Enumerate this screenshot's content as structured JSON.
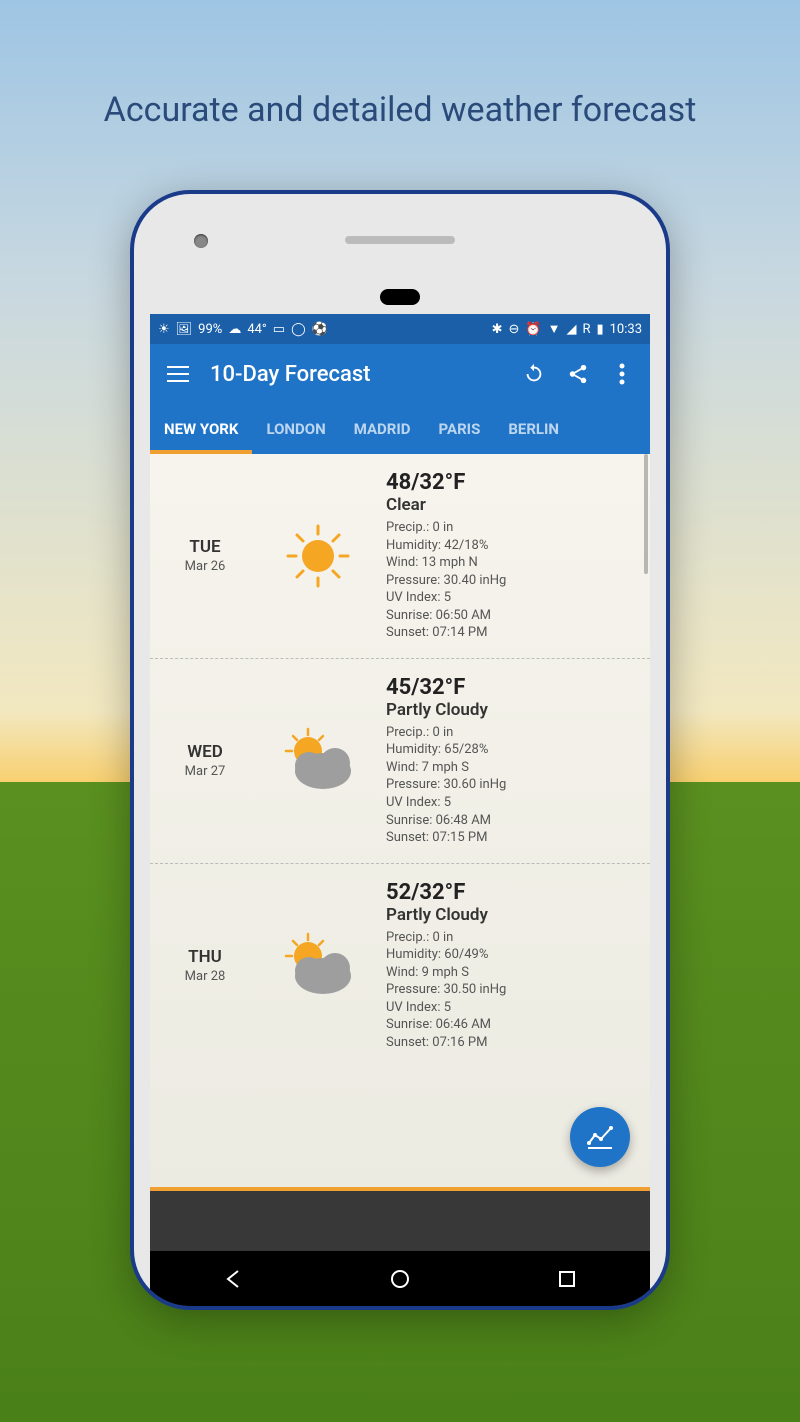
{
  "promo": {
    "title": "Accurate and detailed weather forecast"
  },
  "statusbar": {
    "time": "10:33",
    "battery_pct": "99%",
    "temp": "44°"
  },
  "appbar": {
    "title": "10-Day Forecast"
  },
  "tabs": [
    "NEW YORK",
    "LONDON",
    "MADRID",
    "PARIS",
    "BERLIN"
  ],
  "forecast": [
    {
      "day": "TUE",
      "date": "Mar 26",
      "icon": "sunny",
      "temp": "48/32°F",
      "condition": "Clear",
      "precip": "Precip.: 0 in",
      "humidity": "Humidity: 42/18%",
      "wind": "Wind: 13 mph N",
      "pressure": "Pressure: 30.40 inHg",
      "uv": "UV Index: 5",
      "sunrise": "Sunrise:  06:50 AM",
      "sunset": "Sunset:  07:14 PM"
    },
    {
      "day": "WED",
      "date": "Mar 27",
      "icon": "partly-cloudy",
      "temp": "45/32°F",
      "condition": "Partly Cloudy",
      "precip": "Precip.: 0 in",
      "humidity": "Humidity: 65/28%",
      "wind": "Wind: 7 mph S",
      "pressure": "Pressure: 30.60 inHg",
      "uv": "UV Index: 5",
      "sunrise": "Sunrise:  06:48 AM",
      "sunset": "Sunset:  07:15 PM"
    },
    {
      "day": "THU",
      "date": "Mar 28",
      "icon": "partly-cloudy",
      "temp": "52/32°F",
      "condition": "Partly Cloudy",
      "precip": "Precip.: 0 in",
      "humidity": "Humidity: 60/49%",
      "wind": "Wind: 9 mph S",
      "pressure": "Pressure: 30.50 inHg",
      "uv": "UV Index: 5",
      "sunrise": "Sunrise:  06:46 AM",
      "sunset": "Sunset:  07:16 PM"
    }
  ]
}
